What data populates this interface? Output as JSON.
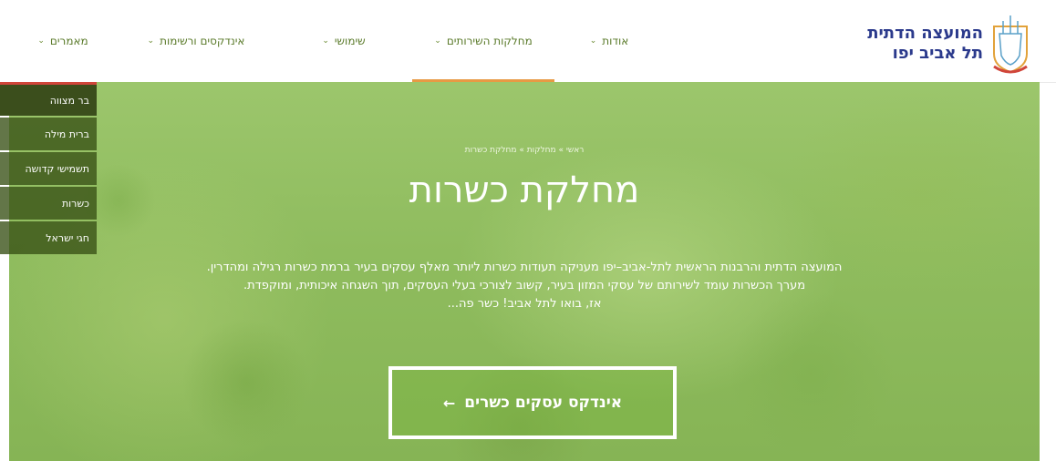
{
  "header": {
    "logo_line1": "המועצה הדתית",
    "logo_line2": "תל אביב יפו",
    "nav": [
      {
        "label": "אודות",
        "active": false
      },
      {
        "label": "מחלקות השירותים",
        "active": true
      },
      {
        "label": "שימושי",
        "active": false
      },
      {
        "label": "אינדקסים ורשימות",
        "active": false
      },
      {
        "label": "מאמרים",
        "active": false
      }
    ],
    "chevron": "⌄"
  },
  "side_menu": [
    {
      "label": "בר מצווה"
    },
    {
      "label": "ברית מילה"
    },
    {
      "label": "תשמישי קדושה"
    },
    {
      "label": "כשרות"
    },
    {
      "label": "חגי ישראל"
    }
  ],
  "hero": {
    "breadcrumb": "ראשי » מחלקות » מחלקת כשרות",
    "title": "מחלקת כשרות",
    "desc_line1": "המועצה הדתית והרבנות הראשית לתל-אביב–יפו מעניקה תעודות כשרות ליותר מאלף עסקים בעיר ברמת כשרות רגילה ומהדרין.",
    "desc_line2": "מערך הכשרות עומד לשירותם של עסקי המזון בעיר, קשוב לצורכי בעלי העסקים, תוך השגחה איכותית, ומוקפדת.",
    "desc_line3": "אז, בואו לתל אביב! כשר פה...",
    "cta_label": "אינדקס עסקים כשרים",
    "cta_arrow": "←"
  },
  "colors": {
    "brand_blue": "#2b3a8c",
    "nav_text": "#5a7a2a",
    "active_underline": "#e79a44",
    "hero_green": "#8fbc5e",
    "side_menu_bg": "#3b4e1c"
  }
}
